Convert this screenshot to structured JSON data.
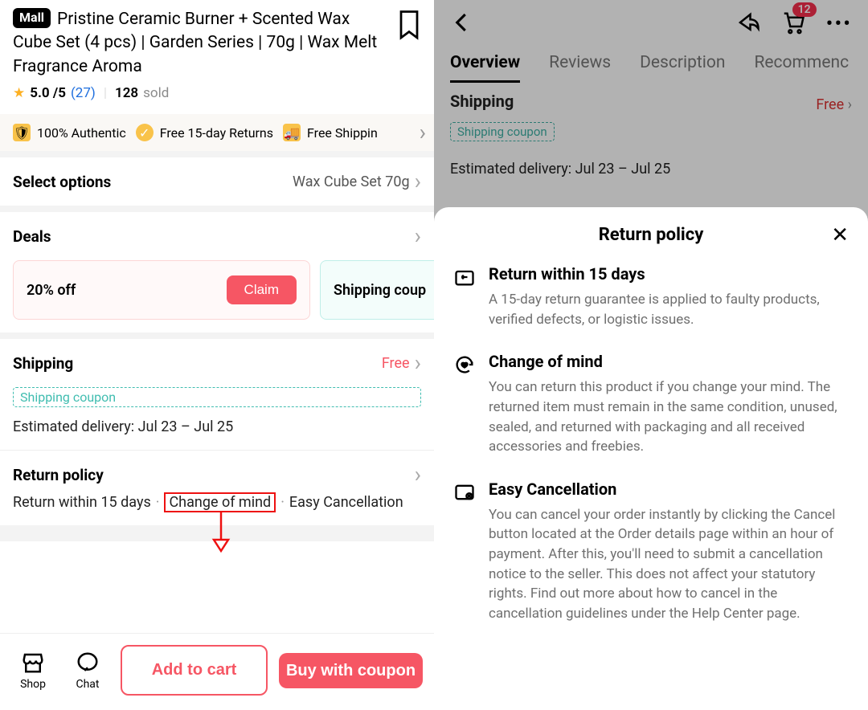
{
  "left": {
    "mall_badge": "Mall",
    "title": "Pristine Ceramic Burner + Scented Wax Cube Set (4 pcs) | Garden Series | 70g | Wax Melt Fragrance Aroma",
    "rating": {
      "score": "5.0 /5",
      "count": "(27)",
      "sold_num": "128",
      "sold_label": "sold"
    },
    "badges": {
      "authentic": "100% Authentic",
      "returns": "Free 15-day Returns",
      "shipping": "Free Shippin"
    },
    "select_options": {
      "label": "Select options",
      "value": "Wax Cube Set 70g"
    },
    "deals": {
      "label": "Deals",
      "discount": "20% off",
      "claim": "Claim",
      "ship_card": "Shipping coup"
    },
    "shipping": {
      "label": "Shipping",
      "free": "Free",
      "coupon_chip": "Shipping coupon",
      "estimated": "Estimated delivery: Jul 23 – Jul 25"
    },
    "return_policy": {
      "label": "Return policy",
      "item1": "Return within 15 days",
      "item2": "Change of mind",
      "item3": "Easy Cancellation"
    },
    "bottom": {
      "shop": "Shop",
      "chat": "Chat",
      "add_cart": "Add to cart",
      "buy": "Buy with coupon"
    }
  },
  "right": {
    "cart_count": "12",
    "tabs": {
      "overview": "Overview",
      "reviews": "Reviews",
      "description": "Description",
      "recommend": "Recommenc"
    },
    "bg_shipping": {
      "title": "Shipping",
      "free": "Free",
      "coupon": "Shipping coupon",
      "estimated": "Estimated delivery: Jul 23 – Jul 25"
    },
    "sheet": {
      "title": "Return policy",
      "items": [
        {
          "title": "Return within 15 days",
          "body": "A 15-day return guarantee is applied to faulty products, verified defects, or logistic issues."
        },
        {
          "title": "Change of mind",
          "body": "You can return this product if you change your mind. The returned item must remain in the same condition, unused, sealed, and returned with packaging and all received accessories and freebies."
        },
        {
          "title": "Easy Cancellation",
          "body": "You can cancel your order instantly by clicking the Cancel button located at the Order details page within an hour of payment. After this, you'll need to submit a cancellation notice to the seller. This does not affect your statutory rights. Find out more about how to cancel in the cancellation guidelines under the Help Center page."
        }
      ]
    }
  }
}
